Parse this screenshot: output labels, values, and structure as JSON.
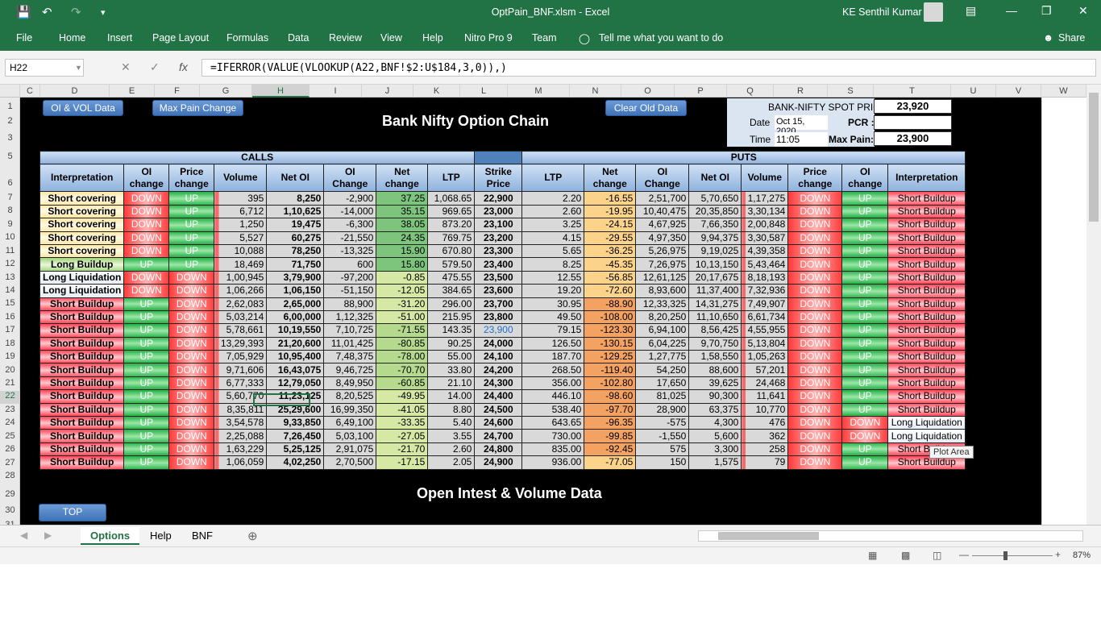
{
  "titlebar": {
    "doc_title": "OptPain_BNF.xlsm  -  Excel",
    "user": "KE Senthil Kumar"
  },
  "ribbon": {
    "tabs": [
      "File",
      "Home",
      "Insert",
      "Page Layout",
      "Formulas",
      "Data",
      "Review",
      "View",
      "Help",
      "Nitro Pro 9",
      "Team"
    ],
    "tellme": "Tell me what you want to do",
    "share": "Share"
  },
  "formula_bar": {
    "name_box": "H22",
    "formula": "=IFERROR(VALUE(VLOOKUP(A22,BNF!$2:U$184,3,0)),)"
  },
  "columns": [
    "C",
    "D",
    "E",
    "F",
    "G",
    "H",
    "I",
    "J",
    "K",
    "L",
    "M",
    "N",
    "O",
    "P",
    "Q",
    "R",
    "S",
    "T",
    "U",
    "V",
    "W"
  ],
  "rows": [
    "1",
    "2",
    "3",
    "5",
    "6",
    "7",
    "8",
    "9",
    "10",
    "11",
    "12",
    "13",
    "14",
    "15",
    "16",
    "17",
    "18",
    "19",
    "20",
    "21",
    "22",
    "23",
    "24",
    "25",
    "26",
    "27",
    "28",
    "29",
    "30",
    "31"
  ],
  "buttons": {
    "oi_vol": "OI & VOL Data",
    "max_pain": "Max Pain  Change",
    "clear": "Clear Old Data",
    "top": "TOP"
  },
  "sheet_title": "Bank Nifty Option Chain",
  "section2_title": "Open Intest & Volume Data",
  "info": {
    "spot_label": "BANK-NIFTY SPOT PRICE",
    "spot": "23,920",
    "date_label": "Date",
    "date": "Oct 15, 2020",
    "pcr_label": "PCR :",
    "pcr": "",
    "time_label": "Time",
    "time": "11:05",
    "maxpain_label": "Max Pain:",
    "maxpain": "23,900"
  },
  "table": {
    "calls_label": "CALLS",
    "puts_label": "PUTS",
    "headers": [
      "Interpretation",
      "OI change",
      "Price change",
      "Volume",
      "Net OI",
      "OI Change",
      "Net change",
      "LTP",
      "Strike Price",
      "LTP",
      "Net change",
      "OI Change",
      "Net OI",
      "Volume",
      "Price change",
      "OI change",
      "Interpretation"
    ],
    "rows": [
      [
        "Short covering",
        "DOWN",
        "UP",
        "395",
        "8,250",
        "-2,900",
        "37.25",
        "1,068.65",
        "22,900",
        "2.20",
        "-16.55",
        "2,51,700",
        "5,70,650",
        "1,17,275",
        "DOWN",
        "UP",
        "Short Buildup"
      ],
      [
        "Short covering",
        "DOWN",
        "UP",
        "6,712",
        "1,10,625",
        "-14,000",
        "35.15",
        "969.65",
        "23,000",
        "2.60",
        "-19.95",
        "10,40,475",
        "20,35,850",
        "3,30,134",
        "DOWN",
        "UP",
        "Short Buildup"
      ],
      [
        "Short covering",
        "DOWN",
        "UP",
        "1,250",
        "19,475",
        "-6,300",
        "38.05",
        "873.20",
        "23,100",
        "3.25",
        "-24.15",
        "4,67,925",
        "7,66,350",
        "2,00,848",
        "DOWN",
        "UP",
        "Short Buildup"
      ],
      [
        "Short covering",
        "DOWN",
        "UP",
        "5,527",
        "60,275",
        "-21,550",
        "24.35",
        "769.75",
        "23,200",
        "4.15",
        "-29.55",
        "4,97,350",
        "9,94,375",
        "3,30,587",
        "DOWN",
        "UP",
        "Short Buildup"
      ],
      [
        "Short covering",
        "DOWN",
        "UP",
        "10,088",
        "78,250",
        "-13,325",
        "15.90",
        "670.80",
        "23,300",
        "5.65",
        "-36.25",
        "5,26,975",
        "9,19,025",
        "4,39,358",
        "DOWN",
        "UP",
        "Short Buildup"
      ],
      [
        "Long Buildup",
        "UP",
        "UP",
        "18,469",
        "71,750",
        "600",
        "15.80",
        "579.50",
        "23,400",
        "8.25",
        "-45.35",
        "7,26,975",
        "10,13,150",
        "5,43,464",
        "DOWN",
        "UP",
        "Short Buildup"
      ],
      [
        "Long Liquidation",
        "DOWN",
        "DOWN",
        "1,00,945",
        "3,79,900",
        "-97,200",
        "-0.85",
        "475.55",
        "23,500",
        "12.55",
        "-56.85",
        "12,61,125",
        "20,17,675",
        "8,18,193",
        "DOWN",
        "UP",
        "Short Buildup"
      ],
      [
        "Long Liquidation",
        "DOWN",
        "DOWN",
        "1,06,266",
        "1,06,150",
        "-51,150",
        "-12.05",
        "384.65",
        "23,600",
        "19.20",
        "-72.60",
        "8,93,600",
        "11,37,400",
        "7,32,936",
        "DOWN",
        "UP",
        "Short Buildup"
      ],
      [
        "Short Buildup",
        "UP",
        "DOWN",
        "2,62,083",
        "2,65,000",
        "88,900",
        "-31.20",
        "296.00",
        "23,700",
        "30.95",
        "-88.90",
        "12,33,325",
        "14,31,275",
        "7,49,907",
        "DOWN",
        "UP",
        "Short Buildup"
      ],
      [
        "Short Buildup",
        "UP",
        "DOWN",
        "5,03,214",
        "6,00,000",
        "1,12,325",
        "-51.00",
        "215.95",
        "23,800",
        "49.50",
        "-108.00",
        "8,20,250",
        "11,10,650",
        "6,61,734",
        "DOWN",
        "UP",
        "Short Buildup"
      ],
      [
        "Short Buildup",
        "UP",
        "DOWN",
        "5,78,661",
        "10,19,550",
        "7,10,725",
        "-71.55",
        "143.35",
        "23,900",
        "79.15",
        "-123.30",
        "6,94,100",
        "8,56,425",
        "4,55,955",
        "DOWN",
        "UP",
        "Short Buildup"
      ],
      [
        "Short Buildup",
        "UP",
        "DOWN",
        "13,29,393",
        "21,20,600",
        "11,01,425",
        "-80.85",
        "90.25",
        "24,000",
        "126.50",
        "-130.15",
        "6,04,225",
        "9,70,750",
        "5,13,804",
        "DOWN",
        "UP",
        "Short Buildup"
      ],
      [
        "Short Buildup",
        "UP",
        "DOWN",
        "7,05,929",
        "10,95,400",
        "7,48,375",
        "-78.00",
        "55.00",
        "24,100",
        "187.70",
        "-129.25",
        "1,27,775",
        "1,58,550",
        "1,05,263",
        "DOWN",
        "UP",
        "Short Buildup"
      ],
      [
        "Short Buildup",
        "UP",
        "DOWN",
        "9,71,606",
        "16,43,075",
        "9,46,725",
        "-70.70",
        "33.80",
        "24,200",
        "268.50",
        "-119.40",
        "54,250",
        "88,600",
        "57,201",
        "DOWN",
        "UP",
        "Short Buildup"
      ],
      [
        "Short Buildup",
        "UP",
        "DOWN",
        "6,77,333",
        "12,79,050",
        "8,49,950",
        "-60.85",
        "21.10",
        "24,300",
        "356.00",
        "-102.80",
        "17,650",
        "39,625",
        "24,468",
        "DOWN",
        "UP",
        "Short Buildup"
      ],
      [
        "Short Buildup",
        "UP",
        "DOWN",
        "5,60,770",
        "11,23,125",
        "8,20,525",
        "-49.95",
        "14.00",
        "24,400",
        "446.10",
        "-98.60",
        "81,025",
        "90,300",
        "11,641",
        "DOWN",
        "UP",
        "Short Buildup"
      ],
      [
        "Short Buildup",
        "UP",
        "DOWN",
        "8,35,811",
        "25,29,600",
        "16,99,350",
        "-41.05",
        "8.80",
        "24,500",
        "538.40",
        "-97.70",
        "28,900",
        "63,375",
        "10,770",
        "DOWN",
        "UP",
        "Short Buildup"
      ],
      [
        "Short Buildup",
        "UP",
        "DOWN",
        "3,54,578",
        "9,33,850",
        "6,49,100",
        "-33.35",
        "5.40",
        "24,600",
        "643.65",
        "-96.35",
        "-575",
        "4,300",
        "476",
        "DOWN",
        "DOWN",
        "Long Liquidation"
      ],
      [
        "Short Buildup",
        "UP",
        "DOWN",
        "2,25,088",
        "7,26,450",
        "5,03,100",
        "-27.05",
        "3.55",
        "24,700",
        "730.00",
        "-99.85",
        "-1,550",
        "5,600",
        "362",
        "DOWN",
        "DOWN",
        "Long Liquidation"
      ],
      [
        "Short Buildup",
        "UP",
        "DOWN",
        "1,63,229",
        "5,25,125",
        "2,91,075",
        "-21.70",
        "2.60",
        "24,800",
        "835.00",
        "-92.45",
        "575",
        "3,300",
        "258",
        "DOWN",
        "UP",
        "Short Buildup"
      ],
      [
        "Short Buildup",
        "UP",
        "DOWN",
        "1,06,059",
        "4,02,250",
        "2,70,500",
        "-17.15",
        "2.05",
        "24,900",
        "936.00",
        "-77.05",
        "150",
        "1,575",
        "79",
        "DOWN",
        "UP",
        "Short Buildup"
      ]
    ]
  },
  "tooltip": "Plot Area",
  "sheet_tabs": [
    "Options",
    "Help",
    "BNF"
  ],
  "status": {
    "zoom": "87%"
  }
}
